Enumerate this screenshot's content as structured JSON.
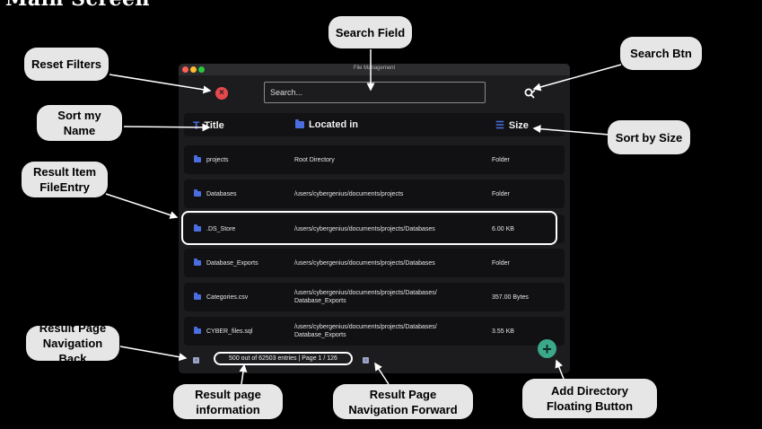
{
  "page_title": "Main Screen",
  "window": {
    "title": "File Management"
  },
  "search": {
    "placeholder": "Search..."
  },
  "columns": {
    "title": "Title",
    "located_in": "Located in",
    "size": "Size"
  },
  "rows": [
    {
      "title": "projects",
      "location": "Root Directory",
      "size": "Folder"
    },
    {
      "title": "Databases",
      "location": "/users/cybergenius/documents/projects",
      "size": "Folder"
    },
    {
      "title": ".DS_Store",
      "location": "/users/cybergenius/documents/projects/Databases",
      "size": "6.00 KB"
    },
    {
      "title": "Database_Exports",
      "location": "/users/cybergenius/documents/projects/Databases",
      "size": "Folder"
    },
    {
      "title": "Categories.csv",
      "location": "/users/cybergenius/documents/projects/Databases/ Database_Exports",
      "size": "357.00 Bytes"
    },
    {
      "title": "CYBER_files.sql",
      "location": "/users/cybergenius/documents/projects/Databases/ Database_Exports",
      "size": "3.55 KB"
    }
  ],
  "pagination": {
    "info": "500 out of 62503 entries | Page 1 / 126"
  },
  "callouts": {
    "search_field": "Search Field",
    "reset_filters": "Reset Filters",
    "search_btn": "Search Btn",
    "sort_name": "Sort my Name",
    "sort_size": "Sort by Size",
    "result_item": "Result Item FileEntry",
    "nav_back": "Result Page Navigation Back",
    "page_info": "Result page information",
    "nav_forward": "Result Page Navigation Forward",
    "add_dir": "Add Directory Floating Button"
  },
  "colors": {
    "background": "#000000",
    "window": "#1c1c1e",
    "folder_icon": "#4a6ee0",
    "fab": "#3ba88a",
    "reset": "#e5484d"
  },
  "icons": {
    "reset": "close-circle-icon",
    "search": "magnifier-icon",
    "title_col": "text-icon",
    "location_col": "folder-icon",
    "size_col": "list-icon",
    "row": "folder-icon",
    "back": "chevron-left-icon",
    "forward": "chevron-right-icon",
    "add": "plus-icon"
  }
}
